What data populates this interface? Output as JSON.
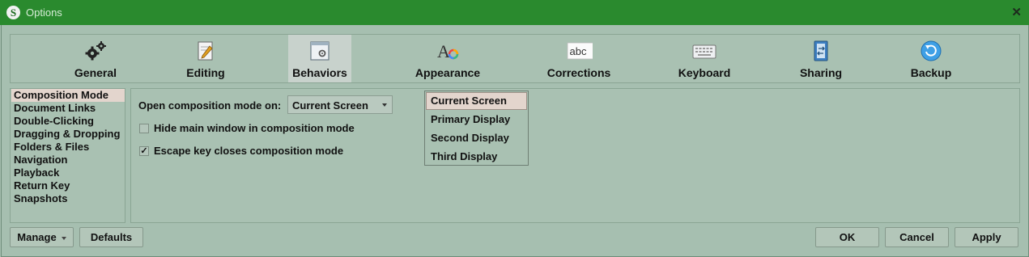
{
  "window": {
    "app_icon_letter": "S",
    "title": "Options",
    "close_glyph": "✕"
  },
  "toolbar": {
    "tabs": [
      {
        "label": "General",
        "icon": "gears-icon",
        "active": false
      },
      {
        "label": "Editing",
        "icon": "edit-page-icon",
        "active": false
      },
      {
        "label": "Behaviors",
        "icon": "window-gear-icon",
        "active": true
      },
      {
        "label": "Appearance",
        "icon": "font-color-icon",
        "active": false
      },
      {
        "label": "Corrections",
        "icon": "abc-spelling-icon",
        "active": false
      },
      {
        "label": "Keyboard",
        "icon": "keyboard-icon",
        "active": false
      },
      {
        "label": "Sharing",
        "icon": "sharing-icon",
        "active": false
      },
      {
        "label": "Backup",
        "icon": "backup-icon",
        "active": false
      }
    ]
  },
  "sidebar": {
    "items": [
      {
        "label": "Composition Mode",
        "selected": true
      },
      {
        "label": "Document Links",
        "selected": false
      },
      {
        "label": "Double-Clicking",
        "selected": false
      },
      {
        "label": "Dragging & Dropping",
        "selected": false
      },
      {
        "label": "Folders & Files",
        "selected": false
      },
      {
        "label": "Navigation",
        "selected": false
      },
      {
        "label": "Playback",
        "selected": false
      },
      {
        "label": "Return Key",
        "selected": false
      },
      {
        "label": "Snapshots",
        "selected": false
      }
    ]
  },
  "settings": {
    "open_on_label": "Open composition mode on:",
    "open_on_value": "Current Screen",
    "hide_main_label": "Hide main window in composition mode",
    "hide_main_checked": false,
    "escape_label": "Escape key closes composition mode",
    "escape_checked": true,
    "check_glyph": "✓"
  },
  "dropdown": {
    "options": [
      "Current Screen",
      "Primary Display",
      "Second Display",
      "Third Display"
    ],
    "selected": "Current Screen"
  },
  "footer": {
    "manage_label": "Manage",
    "defaults_label": "Defaults",
    "ok_label": "OK",
    "cancel_label": "Cancel",
    "apply_label": "Apply"
  },
  "colors": {
    "titlebar": "#2a8a2e",
    "background": "#a6bfb0",
    "selection": "#e3d5cd",
    "active_tab": "#c8d2cc"
  }
}
